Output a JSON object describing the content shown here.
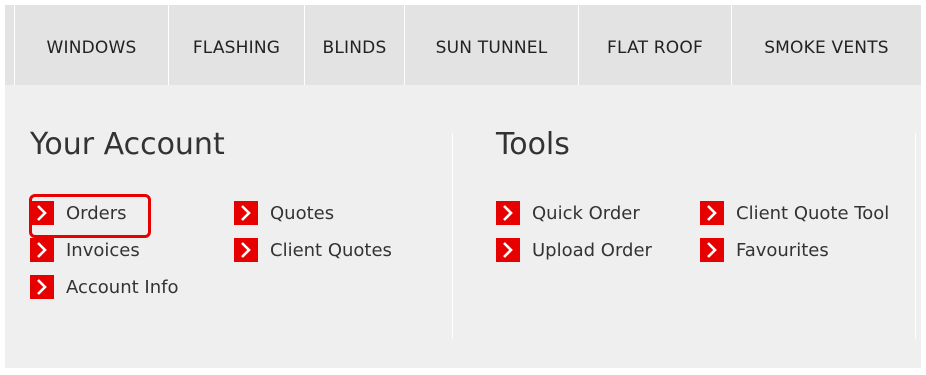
{
  "nav": {
    "items": [
      {
        "label": "WINDOWS"
      },
      {
        "label": "FLASHING"
      },
      {
        "label": "BLINDS"
      },
      {
        "label": "SUN TUNNEL"
      },
      {
        "label": "FLAT ROOF"
      },
      {
        "label": "SMOKE VENTS"
      }
    ]
  },
  "account": {
    "title": "Your Account",
    "links": {
      "orders": "Orders",
      "invoices": "Invoices",
      "account_info": "Account Info",
      "quotes": "Quotes",
      "client_quotes": "Client Quotes"
    }
  },
  "tools": {
    "title": "Tools",
    "links": {
      "quick_order": "Quick Order",
      "upload_order": "Upload Order",
      "client_quote_tool": "Client Quote Tool",
      "favourites": "Favourites"
    }
  },
  "icons": {
    "link_bullet": "chevron-right-icon"
  },
  "colors": {
    "accent": "#e60000",
    "nav_bg": "#e3e3e3",
    "panel_bg": "#efefef",
    "text": "#333333"
  }
}
